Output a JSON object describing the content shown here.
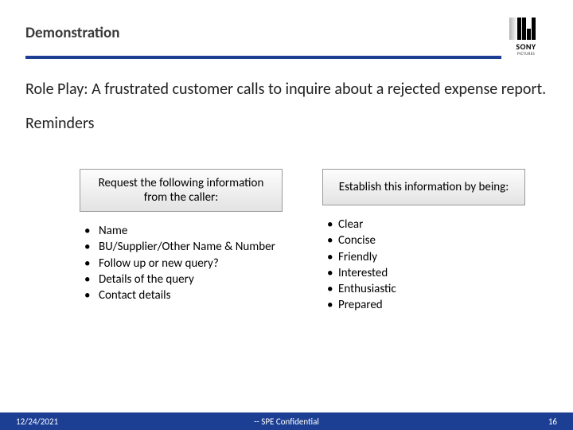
{
  "header": {
    "title": "Demonstration"
  },
  "logo": {
    "brand": "SONY",
    "sub": "PICTURES"
  },
  "body": {
    "scenario": "Role Play: A frustrated customer calls to inquire about a rejected expense report.",
    "reminders_label": "Reminders"
  },
  "left": {
    "heading": "Request the following information from the caller:",
    "items": [
      "Name",
      "BU/Supplier/Other Name & Number",
      "Follow up or new query?",
      "Details of the query",
      "Contact details"
    ]
  },
  "right": {
    "heading": "Establish this information by being:",
    "items": [
      "Clear",
      "Concise",
      "Friendly",
      "Interested",
      "Enthusiastic",
      "Prepared"
    ]
  },
  "footer": {
    "date": "12/24/2021",
    "confidential": "-- SPE Confidential",
    "page": "16"
  }
}
